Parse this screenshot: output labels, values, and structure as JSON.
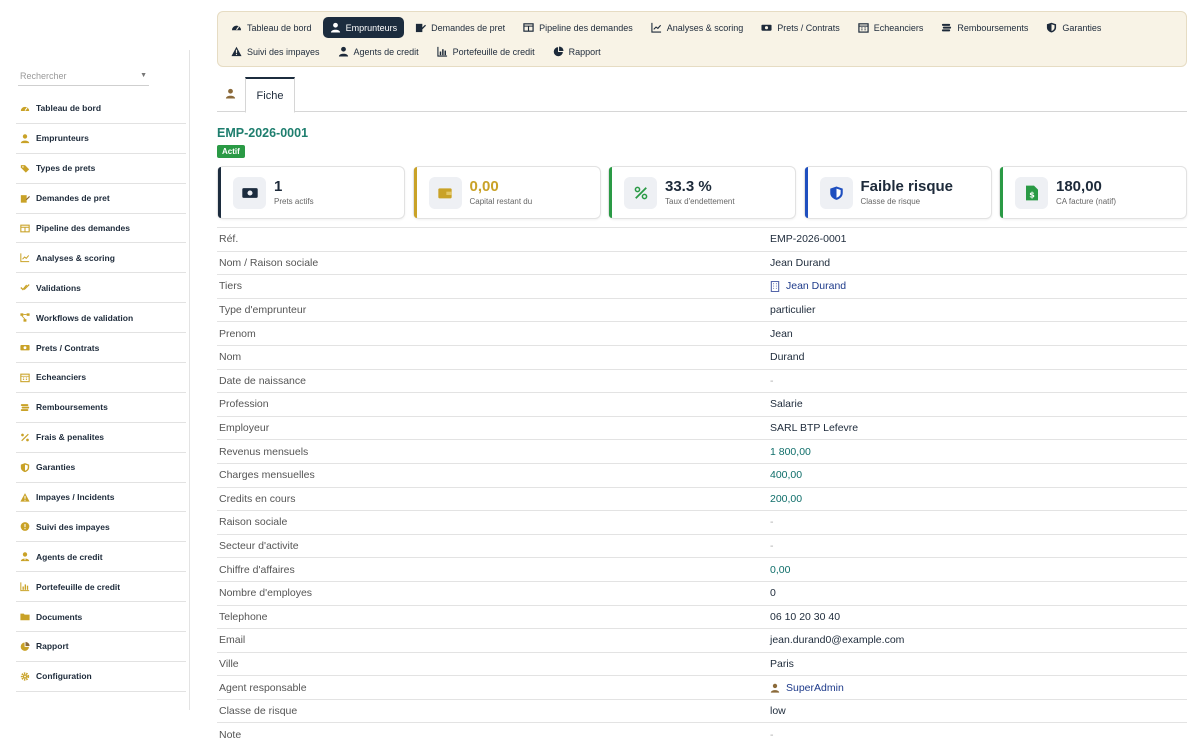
{
  "colors": {
    "accent_dark": "#1c2c3e",
    "brand_teal": "#1e7e6e",
    "status_green": "#2a9a45",
    "icon_gold": "#c9a227",
    "icon_brown": "#8b6a3a"
  },
  "sidebar": {
    "search_placeholder": "Rechercher",
    "items": [
      {
        "label": "Tableau de bord",
        "icon": "dashboard-icon"
      },
      {
        "label": "Emprunteurs",
        "icon": "user-icon"
      },
      {
        "label": "Types de prets",
        "icon": "tags-icon"
      },
      {
        "label": "Demandes de pret",
        "icon": "edit-icon"
      },
      {
        "label": "Pipeline des demandes",
        "icon": "columns-icon"
      },
      {
        "label": "Analyses & scoring",
        "icon": "chart-line-icon"
      },
      {
        "label": "Validations",
        "icon": "check-double-icon"
      },
      {
        "label": "Workflows de validation",
        "icon": "workflow-icon"
      },
      {
        "label": "Prets / Contrats",
        "icon": "money-icon"
      },
      {
        "label": "Echeanciers",
        "icon": "calendar-icon"
      },
      {
        "label": "Remboursements",
        "icon": "coins-icon"
      },
      {
        "label": "Frais & penalites",
        "icon": "percent-icon"
      },
      {
        "label": "Garanties",
        "icon": "shield-icon"
      },
      {
        "label": "Impayes / Incidents",
        "icon": "warning-icon"
      },
      {
        "label": "Suivi des impayes",
        "icon": "alert-circle-icon"
      },
      {
        "label": "Agents de credit",
        "icon": "user-tie-icon"
      },
      {
        "label": "Portefeuille de credit",
        "icon": "chart-bar-icon"
      },
      {
        "label": "Documents",
        "icon": "folder-icon"
      },
      {
        "label": "Rapport",
        "icon": "pie-chart-icon"
      },
      {
        "label": "Configuration",
        "icon": "gear-icon"
      }
    ]
  },
  "topnav": {
    "row1": [
      {
        "label": "Tableau de bord",
        "icon": "dashboard-icon",
        "active": false
      },
      {
        "label": "Emprunteurs",
        "icon": "user-icon",
        "active": true
      },
      {
        "label": "Demandes de pret",
        "icon": "edit-icon",
        "active": false
      },
      {
        "label": "Pipeline des demandes",
        "icon": "columns-icon",
        "active": false
      },
      {
        "label": "Analyses & scoring",
        "icon": "chart-line-icon",
        "active": false
      },
      {
        "label": "Prets / Contrats",
        "icon": "money-icon",
        "active": false
      },
      {
        "label": "Echeanciers",
        "icon": "calendar-icon",
        "active": false
      },
      {
        "label": "Remboursements",
        "icon": "coins-icon",
        "active": false
      },
      {
        "label": "Garanties",
        "icon": "shield-icon",
        "active": false
      }
    ],
    "row2": [
      {
        "label": "Suivi des impayes",
        "icon": "warning-icon",
        "active": false
      },
      {
        "label": "Agents de credit",
        "icon": "user-tie-icon",
        "active": false
      },
      {
        "label": "Portefeuille de credit",
        "icon": "chart-bar-icon",
        "active": false
      },
      {
        "label": "Rapport",
        "icon": "pie-chart-icon",
        "active": false
      }
    ]
  },
  "tabs": {
    "fiche_label": "Fiche"
  },
  "record": {
    "ref": "EMP-2026-0001",
    "status": "Actif"
  },
  "kpis": [
    {
      "value": "1",
      "label": "Prets actifs",
      "icon": "money-icon",
      "color": "#1c2c3e"
    },
    {
      "value": "0,00",
      "label": "Capital restant du",
      "icon": "wallet-icon",
      "color": "#c9a227"
    },
    {
      "value": "33.3 %",
      "label": "Taux d'endettement",
      "icon": "percent-icon",
      "color": "#2a9a45"
    },
    {
      "value": "Faible risque",
      "label": "Classe de risque",
      "icon": "shield-icon",
      "color": "#1f4fbf"
    },
    {
      "value": "180,00",
      "label": "CA facture (natif)",
      "icon": "invoice-dollar-icon",
      "color": "#2a9a45"
    }
  ],
  "details": [
    {
      "key": "Réf.",
      "value": "EMP-2026-0001",
      "style": "plain"
    },
    {
      "key": "Nom / Raison sociale",
      "value": "Jean Durand",
      "style": "plain"
    },
    {
      "key": "Tiers",
      "value": "Jean Durand",
      "style": "link",
      "icon": "building-icon"
    },
    {
      "key": "Type d'emprunteur",
      "value": "particulier",
      "style": "plain"
    },
    {
      "key": "Prenom",
      "value": "Jean",
      "style": "plain"
    },
    {
      "key": "Nom",
      "value": "Durand",
      "style": "plain"
    },
    {
      "key": "Date de naissance",
      "value": "-",
      "style": "muted"
    },
    {
      "key": "Profession",
      "value": "Salarie",
      "style": "plain"
    },
    {
      "key": "Employeur",
      "value": "SARL BTP Lefevre",
      "style": "plain"
    },
    {
      "key": "Revenus mensuels",
      "value": "1 800,00",
      "style": "num"
    },
    {
      "key": "Charges mensuelles",
      "value": "400,00",
      "style": "num"
    },
    {
      "key": "Credits en cours",
      "value": "200,00",
      "style": "num"
    },
    {
      "key": "Raison sociale",
      "value": "-",
      "style": "muted"
    },
    {
      "key": "Secteur d'activite",
      "value": "-",
      "style": "muted"
    },
    {
      "key": "Chiffre d'affaires",
      "value": "0,00",
      "style": "num"
    },
    {
      "key": "Nombre d'employes",
      "value": "0",
      "style": "plain"
    },
    {
      "key": "Telephone",
      "value": "06 10 20 30 40",
      "style": "plain"
    },
    {
      "key": "Email",
      "value": "jean.durand0@example.com",
      "style": "plain"
    },
    {
      "key": "Ville",
      "value": "Paris",
      "style": "plain"
    },
    {
      "key": "Agent responsable",
      "value": "SuperAdmin",
      "style": "link",
      "icon": "user-icon"
    },
    {
      "key": "Classe de risque",
      "value": "low",
      "style": "plain"
    },
    {
      "key": "Note",
      "value": "-",
      "style": "muted"
    }
  ]
}
